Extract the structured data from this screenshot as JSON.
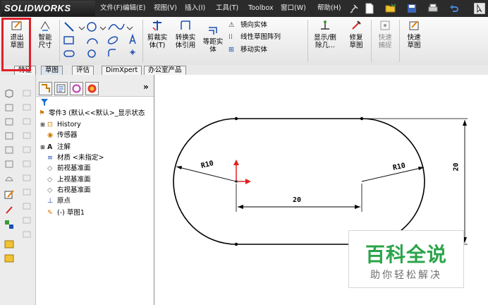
{
  "app": {
    "logo_text": "SOLIDWORKS"
  },
  "menu": [
    {
      "label": "文件(F)"
    },
    {
      "label": "编辑(E)"
    },
    {
      "label": "视图(V)"
    },
    {
      "label": "插入(I)"
    },
    {
      "label": "工具(T)"
    },
    {
      "label": "Toolbox"
    },
    {
      "label": "窗口(W)"
    },
    {
      "label": "帮助(H)"
    }
  ],
  "ribbon": {
    "exit_sketch": "退出草图",
    "smart_dimension": "智能尺寸",
    "trim_entities": "剪裁实体(T)",
    "convert_entities": "转换实体引用",
    "offset_entities": "等距实体",
    "mirror_entities": "镜向实体",
    "linear_pattern": "线性草图阵列",
    "move_entities": "移动实体",
    "display_delete_relations": "显示/删除几...",
    "repair_sketch": "修复草图",
    "quick_snaps": "快速捕捉",
    "rapid_sketch": "快速草图"
  },
  "command_tabs": [
    {
      "label": "特征"
    },
    {
      "label": "草图"
    },
    {
      "label": "评估"
    },
    {
      "label": "DimXpert"
    },
    {
      "label": "办公室产品"
    }
  ],
  "feature_manager": {
    "expand_label": "»",
    "items": [
      {
        "label": "零件3  (默认<<默认>_显示状态"
      },
      {
        "label": "History"
      },
      {
        "label": "传感器"
      },
      {
        "label": "注解"
      },
      {
        "label": "材质 <未指定>"
      },
      {
        "label": "前视基准面"
      },
      {
        "label": "上视基准面"
      },
      {
        "label": "右视基准面"
      },
      {
        "label": "原点"
      },
      {
        "label": "(-) 草图1"
      }
    ]
  },
  "drawing": {
    "dim_r_left": "R10",
    "dim_r_right": "R10",
    "dim_length": "20",
    "dim_height": "20"
  },
  "watermark": {
    "title": "百科全说",
    "subtitle": "助你轻松解决"
  },
  "colors": {
    "highlight_box": "#e0202a",
    "origin": "#e02020",
    "watermark_green": "#2aa44a"
  }
}
